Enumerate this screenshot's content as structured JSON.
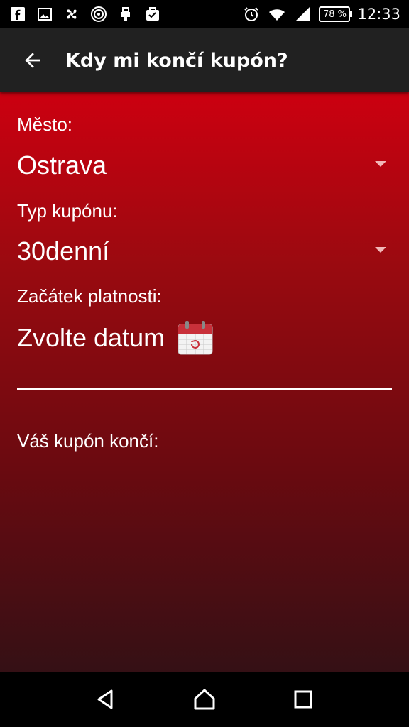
{
  "status_bar": {
    "left_icons": [
      "facebook-icon",
      "image-icon",
      "pinwheel-icon",
      "signal-app-icon",
      "usb-icon",
      "task-done-icon"
    ],
    "battery_text": "78 %",
    "time": "12:33"
  },
  "app_bar": {
    "title": "Kdy mi končí kupón?"
  },
  "form": {
    "city_label": "Město:",
    "city_value": "Ostrava",
    "coupon_type_label": "Typ kupónu:",
    "coupon_type_value": "30denní",
    "start_label": "Začátek platnosti:",
    "start_value": "Zvolte datum",
    "result_label": "Váš kupón končí:"
  },
  "colors": {
    "gradient_top": "#cc0010",
    "gradient_bottom": "#351015",
    "app_bar": "#212121"
  }
}
